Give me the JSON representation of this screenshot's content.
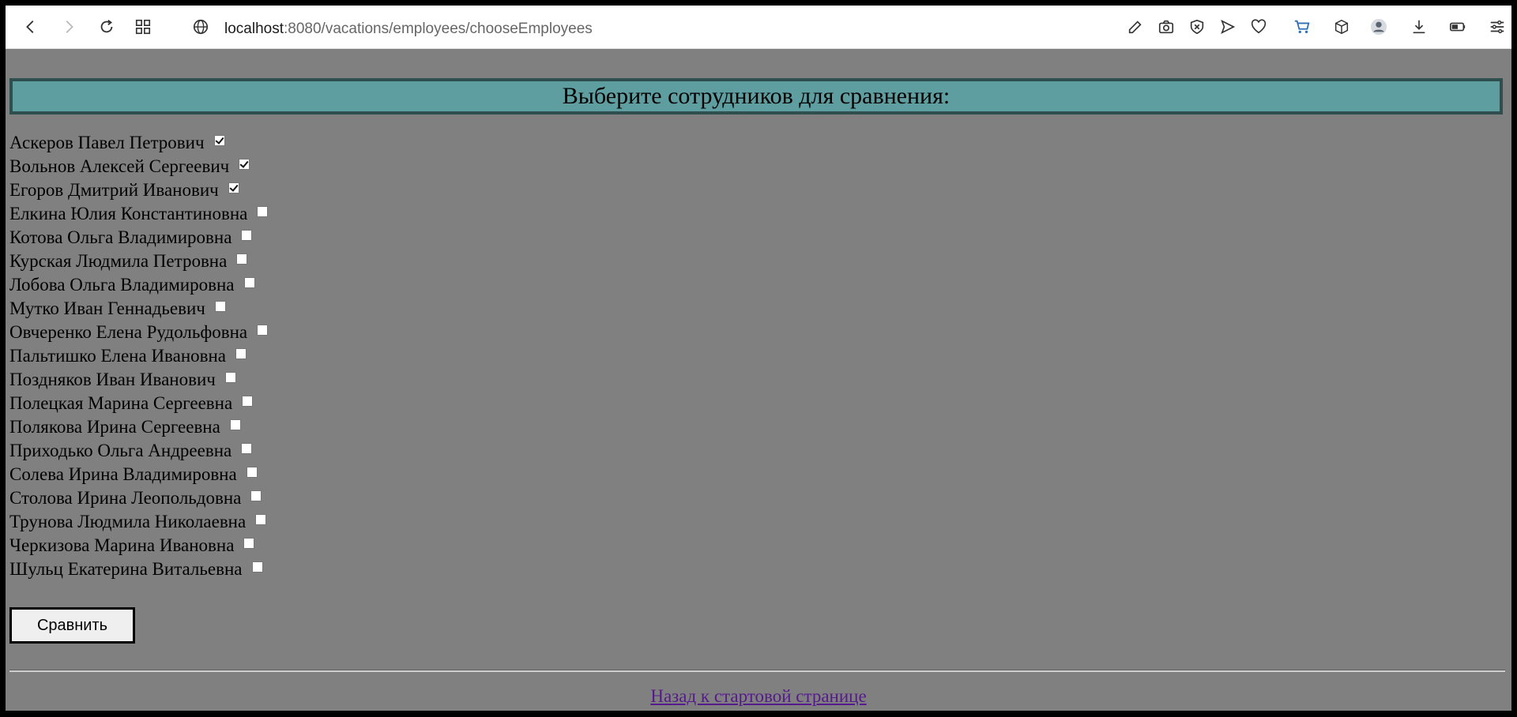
{
  "browser": {
    "url_host": "localhost",
    "url_rest": ":8080/vacations/employees/chooseEmployees",
    "icons": [
      "back-icon",
      "forward-icon",
      "reload-icon",
      "apps-icon",
      "site-info-icon",
      "edit-icon",
      "camera-icon",
      "shield-icon",
      "send-icon",
      "heart-icon",
      "cart-icon",
      "box-icon",
      "profile-icon",
      "download-icon",
      "battery-icon",
      "settings-icon"
    ]
  },
  "page": {
    "title": "Выберите сотрудников для сравнения:",
    "employees": [
      {
        "name": "Аскеров Павел Петрович",
        "checked": true
      },
      {
        "name": "Вольнов Алексей Сергеевич",
        "checked": true
      },
      {
        "name": "Егоров Дмитрий Иванович",
        "checked": true
      },
      {
        "name": "Елкина Юлия Константиновна",
        "checked": false
      },
      {
        "name": "Котова Ольга Владимировна",
        "checked": false
      },
      {
        "name": "Курская Людмила Петровна",
        "checked": false
      },
      {
        "name": "Лобова Ольга Владимировна",
        "checked": false
      },
      {
        "name": "Мутко Иван Геннадьевич",
        "checked": false
      },
      {
        "name": "Овчеренко Елена Рудольфовна",
        "checked": false
      },
      {
        "name": "Пальтишко Елена Ивановна",
        "checked": false
      },
      {
        "name": "Поздняков Иван Иванович",
        "checked": false
      },
      {
        "name": "Полецкая Марина Сергеевна",
        "checked": false
      },
      {
        "name": "Полякова Ирина Сергеевна",
        "checked": false
      },
      {
        "name": "Приходько Ольга Андреевна",
        "checked": false
      },
      {
        "name": "Солева Ирина Владимировна",
        "checked": false
      },
      {
        "name": "Столова Ирина Леопольдовна",
        "checked": false
      },
      {
        "name": "Трунова Людмила Николаевна",
        "checked": false
      },
      {
        "name": "Черкизова Марина Ивановна",
        "checked": false
      },
      {
        "name": "Шульц Екатерина Витальевна",
        "checked": false
      }
    ],
    "compare_label": "Сравнить",
    "back_link": "Назад к стартовой странице"
  },
  "colors": {
    "page_bg": "#808080",
    "header_bg": "#5f9ea0",
    "header_border": "#2f4f4f",
    "link": "#551a8b"
  }
}
